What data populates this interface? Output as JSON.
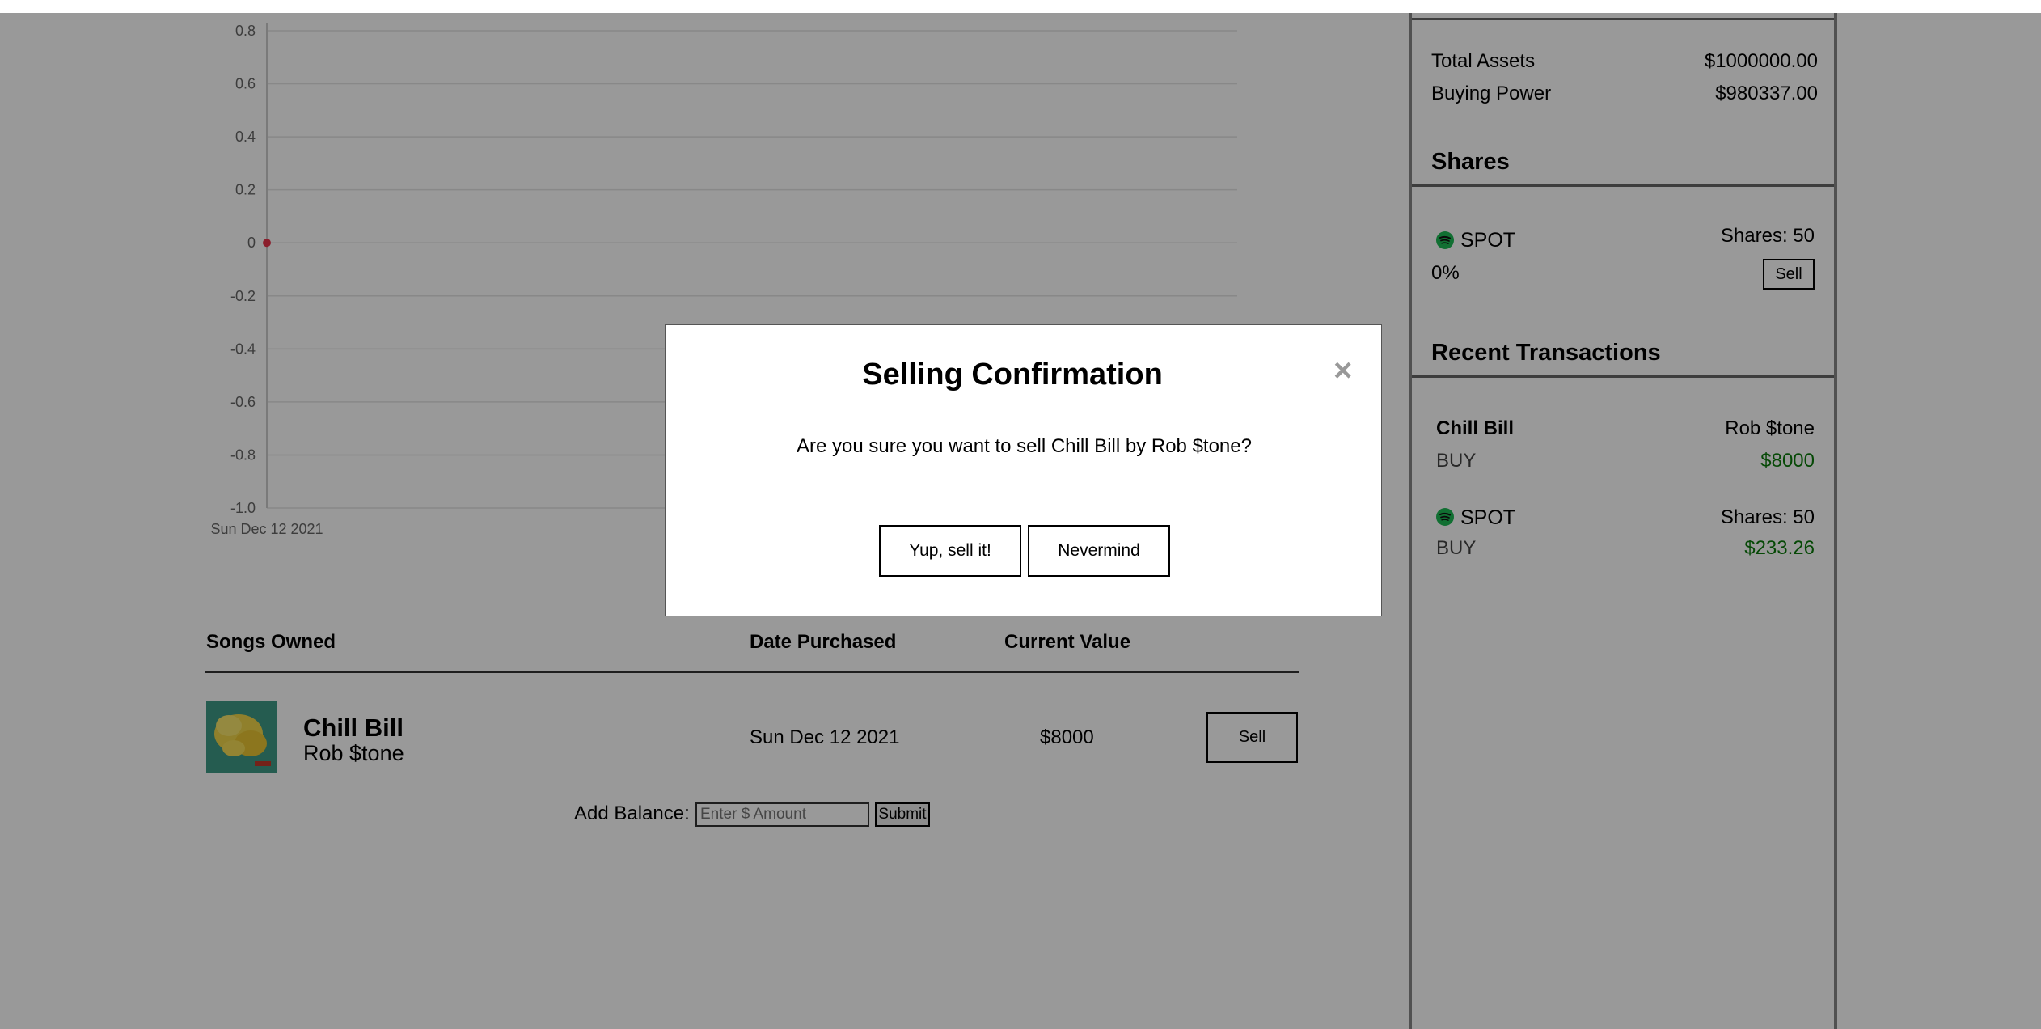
{
  "chart_data": {
    "type": "line",
    "x": [
      "Sun Dec 12 2021"
    ],
    "series": [
      {
        "values": [
          0
        ]
      }
    ],
    "ylim": [
      -1.0,
      0.8
    ],
    "y_ticks": [
      "0.8",
      "0.6",
      "0.4",
      "0.2",
      "0",
      "-0.2",
      "-0.4",
      "-0.6",
      "-0.8",
      "-1.0"
    ],
    "x_tick_labels": [
      "Sun Dec 12 2021"
    ],
    "grid": true,
    "point_color": "#e8334a"
  },
  "songs_table": {
    "headers": {
      "songs": "Songs Owned",
      "date": "Date Purchased",
      "value": "Current Value"
    },
    "rows": [
      {
        "title": "Chill Bill",
        "artist": "Rob $tone",
        "date": "Sun Dec 12 2021",
        "value": "$8000",
        "sell_label": "Sell"
      }
    ]
  },
  "add_balance": {
    "label": "Add Balance:",
    "placeholder": "Enter $ Amount",
    "submit_label": "Submit"
  },
  "sidebar": {
    "total_assets_label": "Total Assets",
    "total_assets_value": "$1000000.00",
    "buying_power_label": "Buying Power",
    "buying_power_value": "$980337.00",
    "shares_heading": "Shares",
    "shares": [
      {
        "ticker": "SPOT",
        "shares_text": "Shares: 50",
        "change": "0%",
        "sell_label": "Sell",
        "icon": "spotify-icon"
      }
    ],
    "recent_heading": "Recent Transactions",
    "transactions": [
      {
        "title": "Chill Bill",
        "artist": "Rob $tone",
        "type": "BUY",
        "amount": "$8000"
      },
      {
        "title": "SPOT",
        "artist": "Shares: 50",
        "type": "BUY",
        "amount": "$233.26",
        "icon": "spotify-icon"
      }
    ]
  },
  "modal": {
    "title": "Selling Confirmation",
    "close_glyph": "×",
    "message": "Are you sure you want to sell Chill Bill by Rob $tone?",
    "confirm_label": "Yup, sell it!",
    "cancel_label": "Nevermind"
  },
  "colors": {
    "accent_green": "#0a7a0a",
    "spotify_green": "#1db954",
    "overlay": "rgba(0,0,0,0.4)"
  }
}
